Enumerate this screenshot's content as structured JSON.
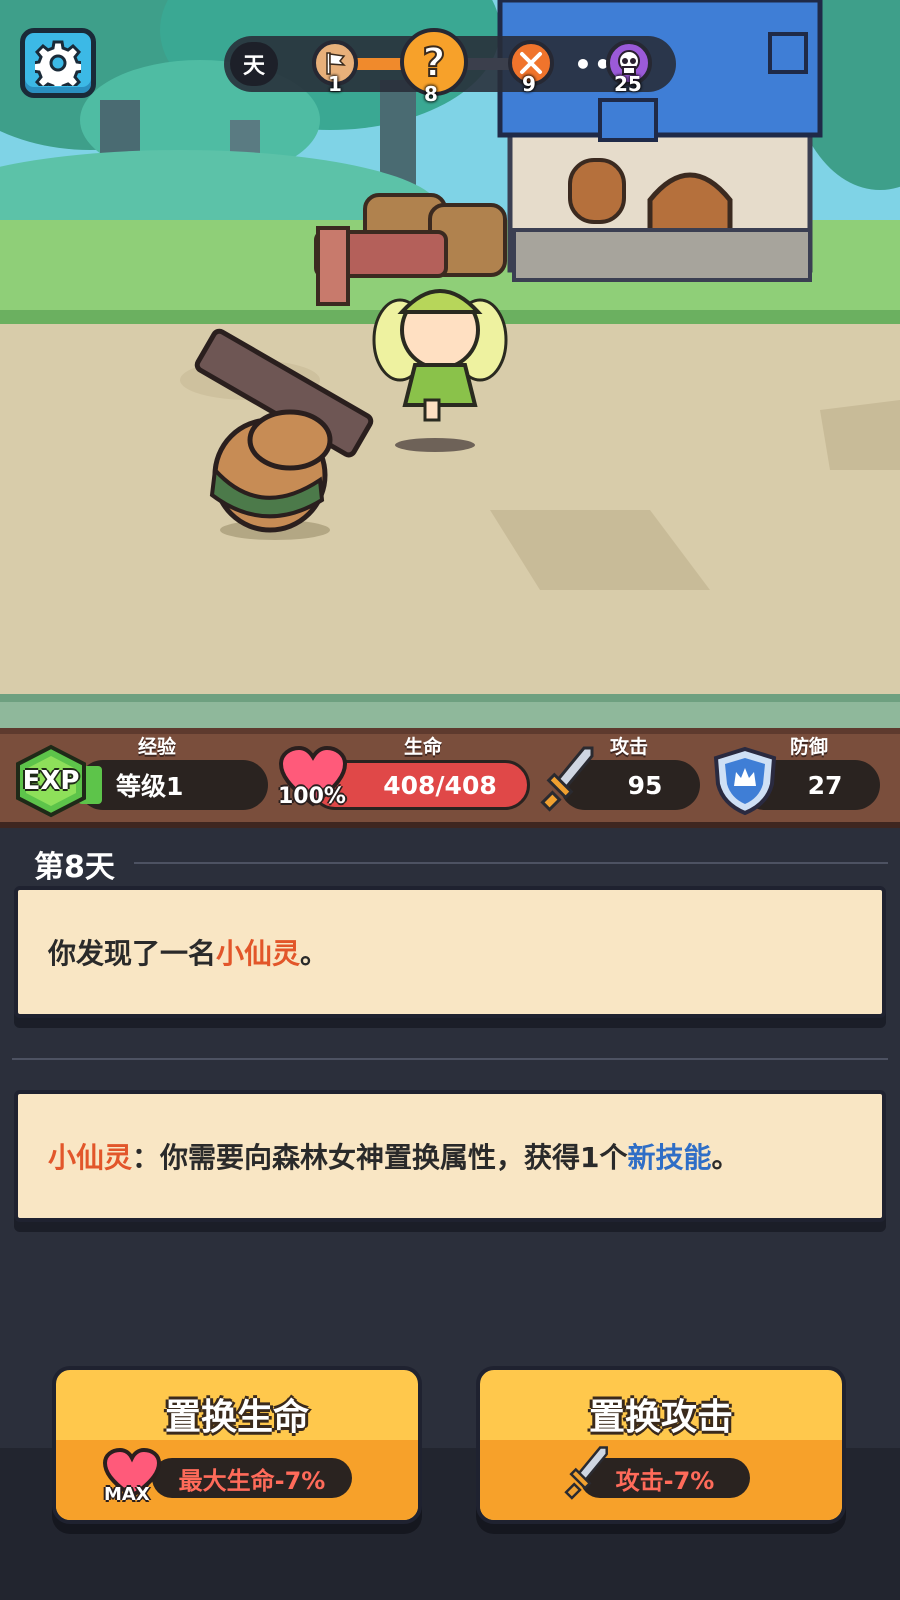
{
  "header": {
    "day_label": "天",
    "nodes": [
      {
        "number": "1",
        "icon": "flag-icon"
      },
      {
        "number": "8",
        "icon": "question-icon"
      },
      {
        "number": "9",
        "icon": "crossed-swords-icon"
      },
      {
        "number": "25",
        "icon": "skull-icon"
      }
    ],
    "dots": "•••"
  },
  "stats": {
    "exp": {
      "badge": "EXP",
      "label": "经验",
      "value": "等级1"
    },
    "hp": {
      "label": "生命",
      "percent": "100%",
      "value": "408/408"
    },
    "attack": {
      "label": "攻击",
      "value": "95"
    },
    "defense": {
      "label": "防御",
      "value": "27"
    }
  },
  "log": {
    "day_title": "第8天",
    "event1": {
      "pre": "你发现了一名",
      "name": "小仙灵",
      "post": "。"
    },
    "event2": {
      "speaker": "小仙灵",
      "text1": "：你需要向森林女神置换属性，获得1个",
      "skill": "新技能",
      "text2": "。"
    }
  },
  "choices": {
    "left": {
      "title": "置换生命",
      "badge": "MAX",
      "effect": "最大生命-7%"
    },
    "right": {
      "title": "置换攻击",
      "effect": "攻击-7%"
    }
  },
  "colors": {
    "accent_orange": "#e2562a",
    "accent_blue": "#2f6ec6",
    "button_yellow": "#ffc84c",
    "hp_red": "#e04848",
    "exp_green": "#5dc44a"
  }
}
